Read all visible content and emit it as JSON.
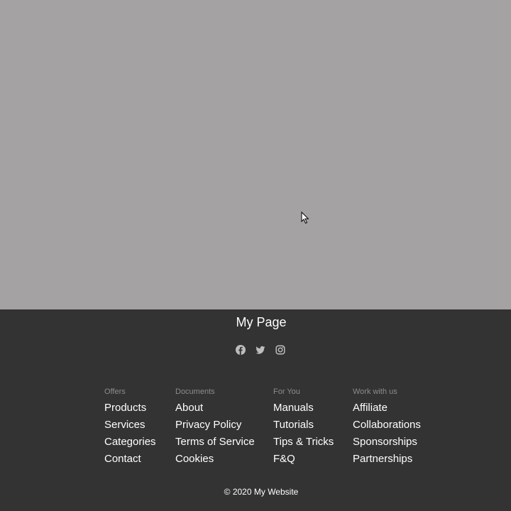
{
  "footer": {
    "brand": "My Page",
    "socials": [
      {
        "icon": "facebook-icon"
      },
      {
        "icon": "twitter-icon"
      },
      {
        "icon": "instagram-icon"
      }
    ],
    "columns": [
      {
        "heading": "Offers",
        "links": [
          "Products",
          "Services",
          "Categories",
          "Contact"
        ]
      },
      {
        "heading": "Documents",
        "links": [
          "About",
          "Privacy Policy",
          "Terms of Service",
          "Cookies"
        ]
      },
      {
        "heading": "For You",
        "links": [
          "Manuals",
          "Tutorials",
          "Tips & Tricks",
          "F&Q"
        ]
      },
      {
        "heading": "Work with us",
        "links": [
          "Affiliate",
          "Collaborations",
          "Sponsorships",
          "Partnerships"
        ]
      }
    ],
    "copyright": "© 2020 My Website"
  },
  "colors": {
    "content_bg": "#a4a2a3",
    "footer_bg": "#333333",
    "heading": "#8c8c8c",
    "icon": "#bdbdbd"
  }
}
